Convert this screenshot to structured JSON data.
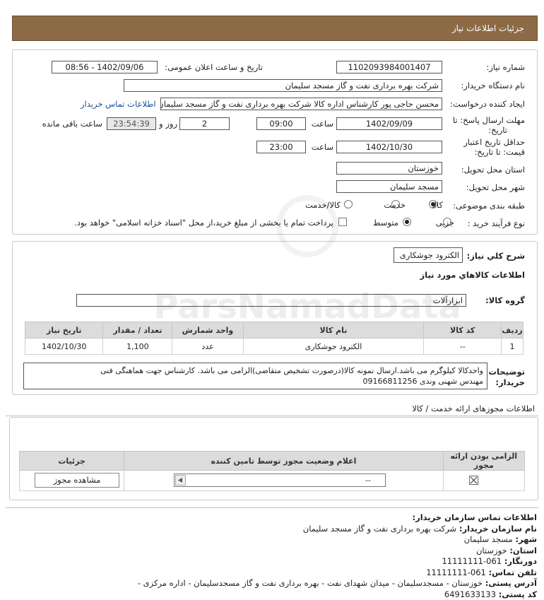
{
  "header": {
    "title": "جزئیات اطلاعات نیاز"
  },
  "form": {
    "need_number_label": "شماره نیاز:",
    "need_number": "1102093984001407",
    "announce_label": "تاریخ و ساعت اعلان عمومی:",
    "announce_value": "1402/09/06 - 08:56",
    "buyer_org_label": "نام دستگاه خریدار:",
    "buyer_org": "شرکت بهره برداری نفت و گاز مسجد سلیمان",
    "creator_label": "ایجاد کننده درخواست:",
    "creator": "محسن حاجی پور کارشناس اداره کالا  شرکت بهره برداری نفت و گاز مسجد سلیمان",
    "contact_link": "اطلاعات تماس خریدار",
    "deadline_label_1": "مهلت ارسال پاسخ: تا",
    "deadline_label_2": "تاریخ:",
    "deadline_date": "1402/09/09",
    "time_label": "ساعت",
    "deadline_time": "09:00",
    "days_value": "2",
    "days_label": "روز و",
    "remaining_time": "23:54:39",
    "remaining_label": "ساعت باقی مانده",
    "validity_label_1": "حداقل تاریخ اعتبار",
    "validity_label_2": "قیمت: تا تاریخ:",
    "validity_date": "1402/10/30",
    "validity_time": "23:00",
    "province_label": "استان محل تحویل:",
    "province": "خوزستان",
    "city_label": "شهر محل تحویل:",
    "city": "مسجد سلیمان",
    "category_label": "طبقه بندی موضوعی:",
    "category_options": [
      "کالا",
      "خدمت",
      "کالا/خدمت"
    ],
    "process_label": "نوع فرآیند خرید :",
    "process_options": [
      "جزیی",
      "متوسط"
    ],
    "payment_note": "پرداخت تمام یا بخشی از مبلغ خرید،از محل \"اسناد خزانه اسلامی\" خواهد بود."
  },
  "need": {
    "summary_label": "شرح کلي نياز:",
    "summary": "الکترود جوشکاری",
    "goods_title": "اطلاعات کالاهاي مورد نياز",
    "group_label": "گروه کالا:",
    "group": "ابزارآلات",
    "table_headers": [
      "ردیف",
      "کد کالا",
      "نام کالا",
      "واحد شمارش",
      "تعداد / مقدار",
      "تاریخ نیاز"
    ],
    "rows": [
      {
        "row": "1",
        "code": "--",
        "name": "الکترود جوشکاری",
        "unit": "عدد",
        "qty": "1,100",
        "date": "1402/10/30"
      }
    ],
    "buyer_notes_label_1": "توضیحات",
    "buyer_notes_label_2": "خریدار:",
    "buyer_notes_line1": "واحدکالا کیلوگرم می باشد.ارسال نمونه کالا(درصورت تشخیص متقاضی)الزامی می باشد. کارشناس جهت هماهنگی فنی",
    "buyer_notes_line2": "مهندس شهنی وندی 09166811256"
  },
  "permits": {
    "title": "اطلاعات مجوزهای ارائه خدمت / کالا",
    "headers": [
      "الزامی بودن ارائه مجوز",
      "اعلام وضعیت مجوز توسط تامین کننده",
      "جزئیات"
    ],
    "select_value": "--",
    "view_button": "مشاهده مجوز"
  },
  "contact": {
    "title": "اطلاعات تماس سازمان خریدار:",
    "org_label": "نام سازمان خریدار:",
    "org": "شرکت بهره برداری نفت و گاز مسجد سلیمان",
    "city_label": "شهر:",
    "city": "مسجد سلیمان",
    "province_label": "استان:",
    "province": "خوزستان",
    "fax_label": "دورنگار:",
    "fax": "061-11111111",
    "phone_label": "تلفن تماس:",
    "phone": "061-11111111",
    "address_label": "آدرس پستی:",
    "address": "خوزستان - مسجدسلیمان - میدان شهدای نفت - بهره برداری نفت و گاز مسجدسلیمان - اداره مرکزی -",
    "postal_label": "کد پستی:",
    "postal": "6491633133"
  },
  "watermark": {
    "brand": "ParsNamadData"
  },
  "colors": {
    "header_bg": "#8b6a45",
    "link": "#1b4f9c",
    "table_header_bg": "#dcdcdc"
  }
}
